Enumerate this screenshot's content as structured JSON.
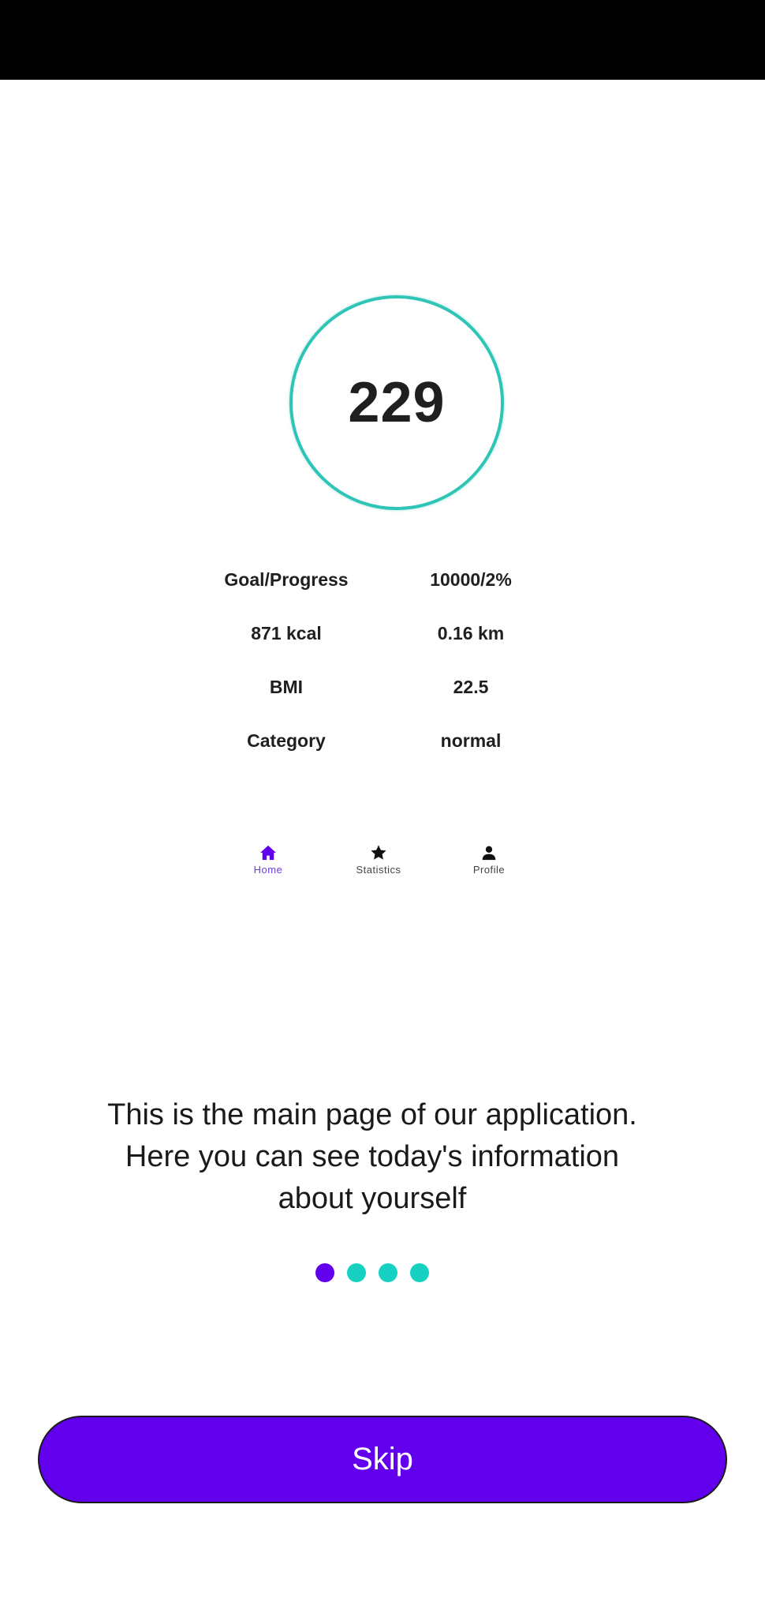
{
  "steps": {
    "count": "229"
  },
  "stats": [
    {
      "label": "Goal/Progress",
      "value": "10000/2%"
    },
    {
      "label": "871 kcal",
      "value": "0.16 km"
    },
    {
      "label": "BMI",
      "value": "22.5"
    },
    {
      "label": "Category",
      "value": "normal"
    }
  ],
  "nav": {
    "items": [
      {
        "label": "Home",
        "icon": "home-icon",
        "active": true
      },
      {
        "label": "Statistics",
        "icon": "star-icon",
        "active": false
      },
      {
        "label": "Profile",
        "icon": "person-icon",
        "active": false
      }
    ]
  },
  "intro": {
    "text": "This is the main page of our application. Here you can see today's information about yourself"
  },
  "pager": {
    "total": 4,
    "current": 1
  },
  "skip": {
    "label": "Skip"
  },
  "colors": {
    "accent": "#6200ee",
    "teal": "#16d1c2",
    "ring": "#2ec4b6"
  }
}
